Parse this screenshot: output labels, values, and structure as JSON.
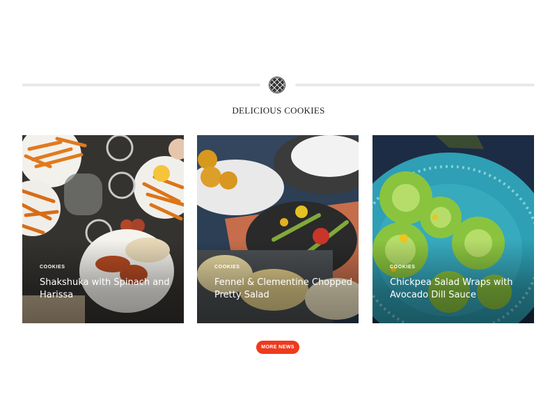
{
  "section": {
    "title": "DELICIOUS COOKIES",
    "badge_icon": "waffle-pattern-icon"
  },
  "cards": [
    {
      "tag": "COOKIES",
      "title": "Shakshuka with Spinach and Harissa",
      "image": "food-table-overhead-photo"
    },
    {
      "tag": "COOKIES",
      "title": "Fennel & Clementine Chopped Pretty Salad",
      "image": "plated-salad-photo"
    },
    {
      "tag": "COOKIES",
      "title": "Chickpea Salad Wraps with Avocado Dill Sauce",
      "image": "green-tomatoes-plate-photo"
    }
  ],
  "more_button": {
    "label": "MORE NEWS"
  },
  "colors": {
    "accent": "#ef3a1c",
    "divider": "#e9e9e9"
  }
}
